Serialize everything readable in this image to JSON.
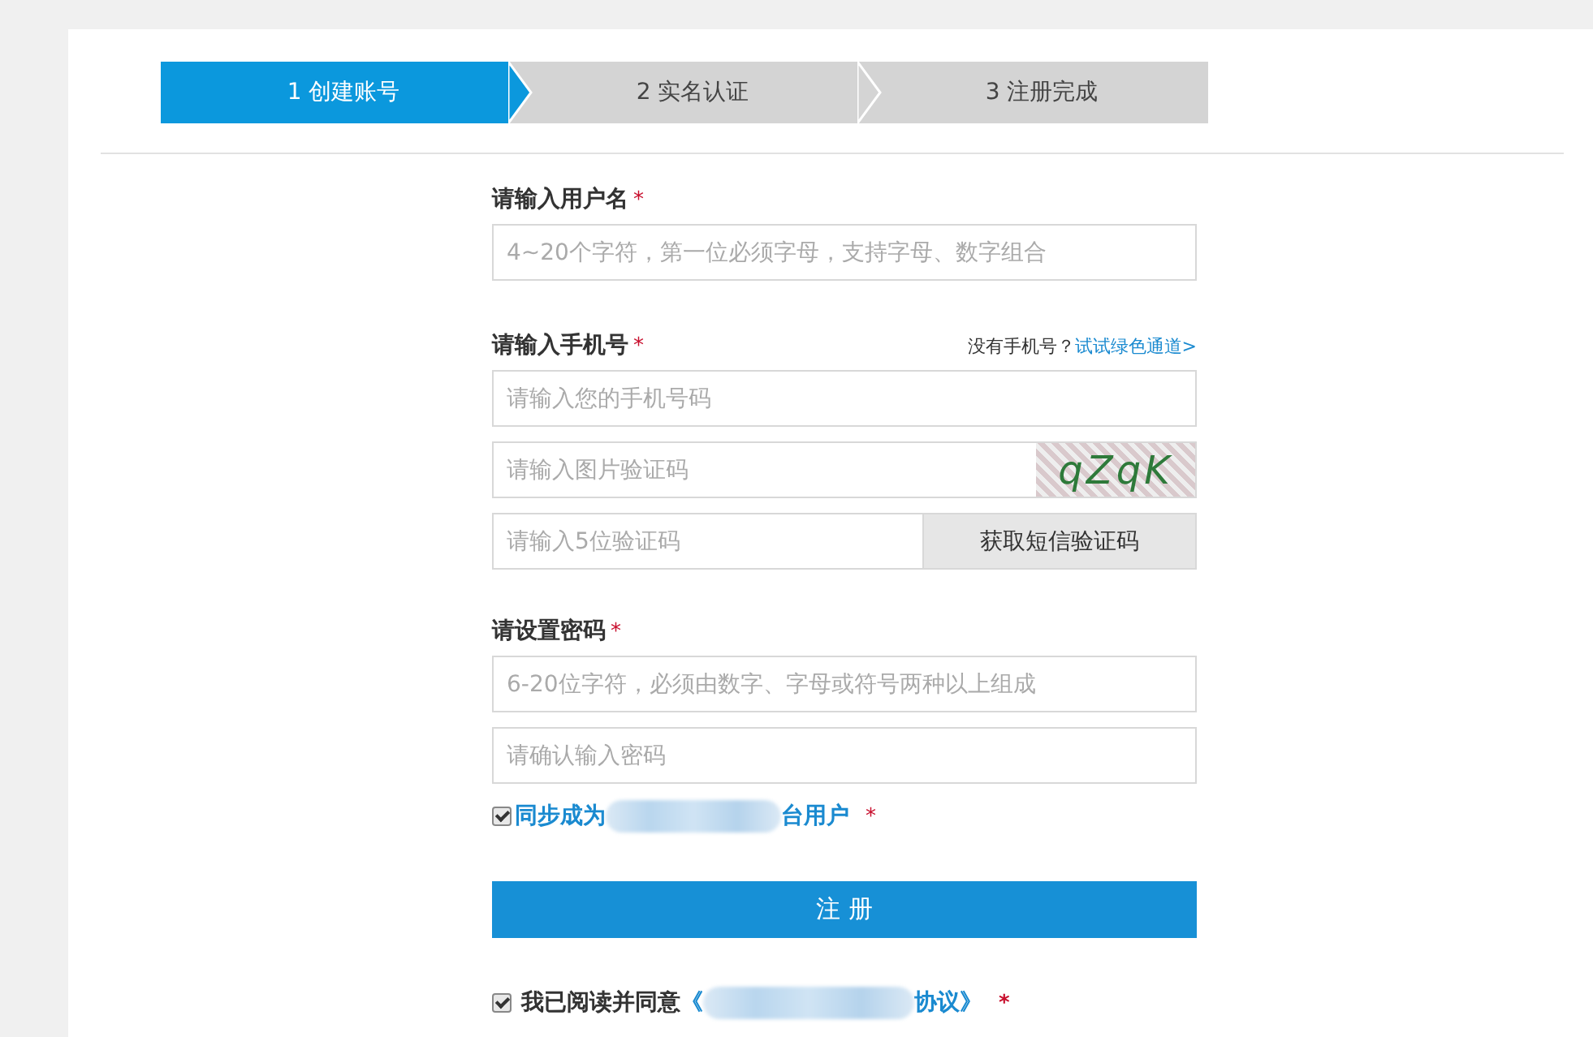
{
  "steps": [
    {
      "number": "1",
      "label": "创建账号",
      "selected": true
    },
    {
      "number": "2",
      "label": "实名认证",
      "selected": false
    },
    {
      "number": "3",
      "label": "注册完成",
      "selected": false
    }
  ],
  "username": {
    "label": "请输入用户名",
    "required": "*",
    "placeholder": "4~20个字符，第一位必须字母，支持字母、数字组合"
  },
  "phone": {
    "label": "请输入手机号",
    "required": "*",
    "hint": "没有手机号？",
    "hint_link": "试试绿色通道>",
    "placeholder": "请输入您的手机号码",
    "captcha_placeholder": "请输入图片验证码",
    "captcha_text": "qZqK",
    "sms_placeholder": "请输入5位验证码",
    "sms_button": "获取短信验证码"
  },
  "password": {
    "label": "请设置密码",
    "required": "*",
    "placeholder": "6-20位字符，必须由数字、字母或符号两种以上组成",
    "confirm_placeholder": "请确认输入密码"
  },
  "sync": {
    "checked": true,
    "text_before": "同步成为",
    "text_after": "台用户",
    "required": "*"
  },
  "register_button": "注 册",
  "agree": {
    "checked": true,
    "text": "我已阅读并同意",
    "link_before": "《",
    "link_after": "协议》",
    "required": "*"
  }
}
